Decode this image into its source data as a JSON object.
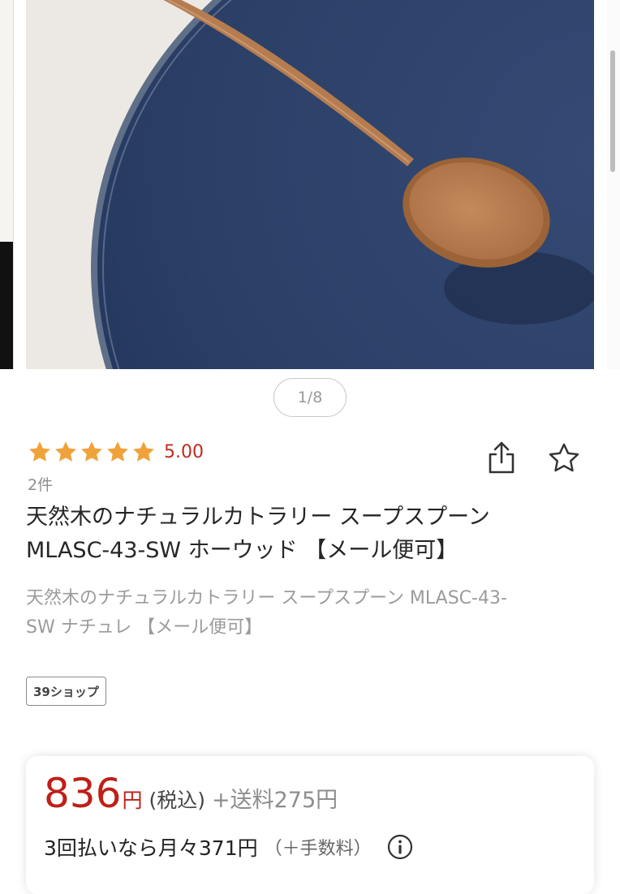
{
  "gallery": {
    "pager": "1/8",
    "image_alt": "wooden soup spoon on blue plate"
  },
  "product": {
    "rating_value": "5.00",
    "rating_stars": 5,
    "review_count": "2件",
    "title_line1": "天然木のナチュラルカトラリー スープスプーン",
    "title_line2": "MLASC-43-SW ホーウッド 【メール便可】",
    "subtitle_line1": "天然木のナチュラルカトラリー スープスプーン MLASC-43-",
    "subtitle_line2": "SW ナチュレ 【メール便可】",
    "shop_badge": "39ショップ"
  },
  "price": {
    "amount": "836",
    "yen": "円",
    "tax": "(税込)",
    "shipping": "+送料275円",
    "installment": "3回払いなら月々371円",
    "installment_fee": "（＋手数料）"
  },
  "icons": {
    "star": "star-icon",
    "share": "share-icon",
    "favorite": "star-outline-icon",
    "info": "info-icon"
  },
  "colors": {
    "star": "#f0a23a",
    "price": "#bf1f17",
    "rating_text": "#bf2b1f",
    "plate": "#2c4168"
  }
}
